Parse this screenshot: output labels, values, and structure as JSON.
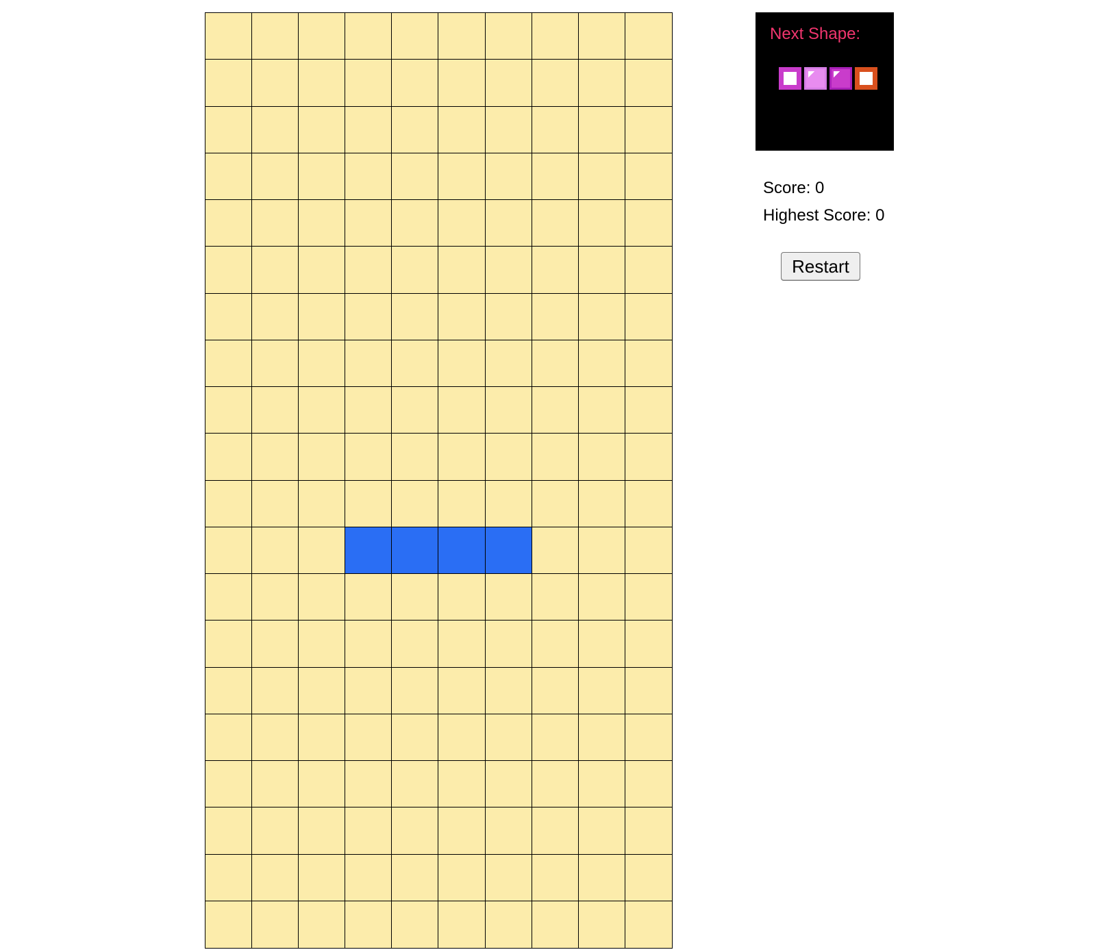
{
  "board": {
    "columns": 10,
    "rows": 20,
    "empty_color": "#fcecab",
    "grid_line_color": "#000000",
    "active_piece": {
      "type": "I",
      "color": "#2a6ef4",
      "cells": [
        [
          11,
          3
        ],
        [
          11,
          4
        ],
        [
          11,
          5
        ],
        [
          11,
          6
        ]
      ]
    }
  },
  "next_shape": {
    "title": "Next Shape:",
    "title_color": "#f0356e",
    "background": "#000000",
    "blocks": [
      {
        "style": "hollow",
        "border_color": "#c93ccb",
        "fill": "#ffffff"
      },
      {
        "style": "shiny",
        "border_color": "#d77ee6",
        "fill": "#e88cf0"
      },
      {
        "style": "shiny",
        "border_color": "#a920b8",
        "fill": "#c93ccb"
      },
      {
        "style": "hollow",
        "border_color": "#d9501e",
        "fill": "#ffffff"
      }
    ]
  },
  "score": {
    "score_text": "Score: 0",
    "highest_text": "Highest Score: 0"
  },
  "controls": {
    "restart_label": "Restart"
  }
}
